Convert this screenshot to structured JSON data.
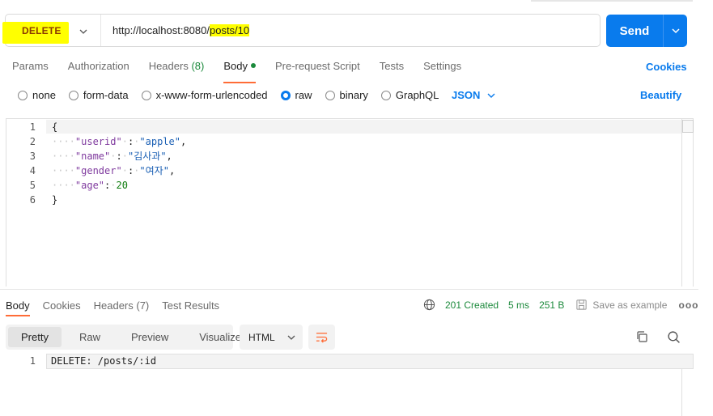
{
  "request": {
    "method": "DELETE",
    "url_base": "http://localhost:8080/",
    "url_path": "posts/10",
    "send_label": "Send"
  },
  "request_tabs": {
    "params": "Params",
    "authorization": "Authorization",
    "headers": "Headers",
    "headers_count": "(8)",
    "body": "Body",
    "prerequest": "Pre-request Script",
    "tests": "Tests",
    "settings": "Settings",
    "cookies": "Cookies"
  },
  "body_types": {
    "none": "none",
    "form_data": "form-data",
    "urlencoded": "x-www-form-urlencoded",
    "raw": "raw",
    "binary": "binary",
    "graphql": "GraphQL",
    "selected": "raw",
    "language": "JSON",
    "beautify": "Beautify"
  },
  "request_body": {
    "line_numbers": [
      "1",
      "2",
      "3",
      "4",
      "5",
      "6"
    ],
    "open_brace": "{",
    "close_brace": "}",
    "fields": [
      {
        "key": "\"userid\"",
        "value": "\"apple\""
      },
      {
        "key": "\"name\"",
        "value": "\"김사과\""
      },
      {
        "key": "\"gender\"",
        "value": "\"여자\""
      },
      {
        "key": "\"age\"",
        "value": "20"
      }
    ]
  },
  "response_tabs": {
    "body": "Body",
    "cookies": "Cookies",
    "headers": "Headers (7)",
    "test_results": "Test Results"
  },
  "response_status": {
    "status": "201 Created",
    "time": "5 ms",
    "size": "251 B",
    "save_label": "Save as example",
    "more": "ooo"
  },
  "view_tabs": {
    "pretty": "Pretty",
    "raw": "Raw",
    "preview": "Preview",
    "visualize": "Visualize",
    "format": "HTML"
  },
  "response_body": {
    "line_number": "1",
    "text": "DELETE: /posts/:id"
  },
  "colors": {
    "accent": "#097bed",
    "active_tab_underline": "#ff6c37",
    "success": "#1c8a3c",
    "highlight": "#ffff00"
  }
}
